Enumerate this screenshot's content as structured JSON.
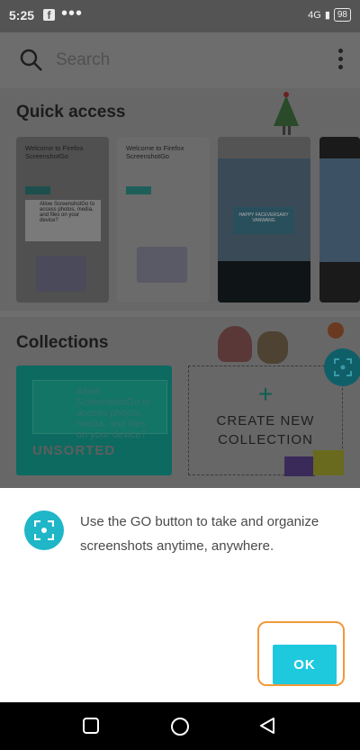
{
  "status": {
    "time": "5:25",
    "signal": "4G",
    "battery": "98"
  },
  "search": {
    "placeholder": "Search"
  },
  "quick_access": {
    "title": "Quick access",
    "thumb1": {
      "heading": "Welcome to Firefox ScreenshotGo",
      "dialog": "Allow ScreenshotGo to access photos, media, and files on your device?"
    },
    "thumb2": {
      "heading": "Welcome to Firefox ScreenshotGo"
    },
    "thumb3": {
      "banner": "HAPPY FACEVERSARY VANWANG"
    }
  },
  "collections": {
    "title": "Collections",
    "unsorted_label": "UNSORTED",
    "unsorted_preview": "Allow ScreenshotGo to access photos, media, and files on your device?",
    "create_plus": "+",
    "create_label_line1": "CREATE NEW",
    "create_label_line2": "COLLECTION"
  },
  "dialog": {
    "message": "Use the GO button to take and organize screenshots anytime, anywhere.",
    "ok_label": "OK"
  },
  "colors": {
    "accent": "#1fc9dd",
    "highlight": "#f29a3a"
  }
}
